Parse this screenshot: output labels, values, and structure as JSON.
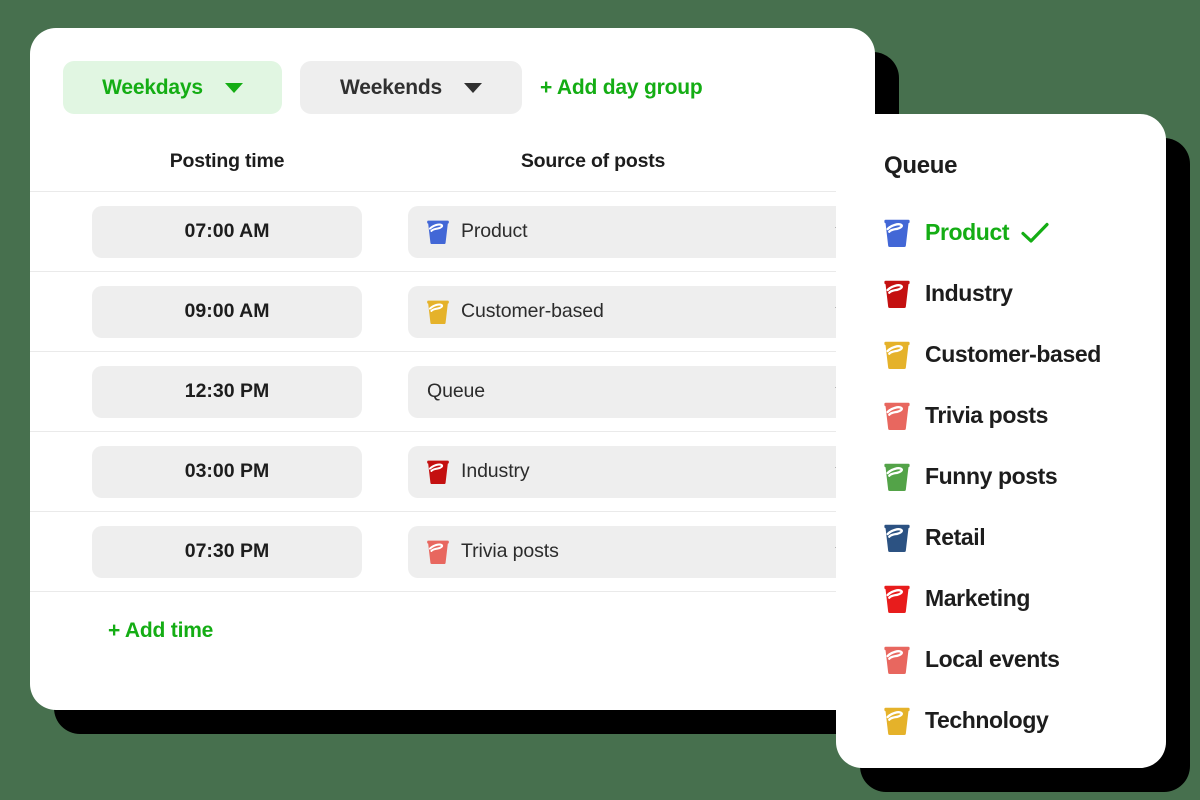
{
  "theme": {
    "background": "#47704e",
    "card": "#ffffff",
    "shadow": "#000000",
    "accent_green": "#14ad14",
    "accent_green_soft": "#e1f6e2",
    "field_gray": "#eeeeee",
    "text_dark": "#1d1d1d",
    "divider": "#eaeaea"
  },
  "day_groups": {
    "active": {
      "label": "Weekdays",
      "caret": "chevron-down-icon"
    },
    "inactive": {
      "label": "Weekends",
      "caret": "chevron-down-icon"
    },
    "add_label": "+ Add day group"
  },
  "table": {
    "headers": {
      "time": "Posting time",
      "source": "Source of posts"
    },
    "rows": [
      {
        "time": "07:00 AM",
        "source": "Product",
        "icon": "bucket-icon",
        "icon_color": "#4267d6",
        "has_icon": true
      },
      {
        "time": "09:00 AM",
        "source": "Customer-based",
        "icon": "bucket-icon",
        "icon_color": "#e5b22a",
        "has_icon": true
      },
      {
        "time": "12:30 PM",
        "source": "Queue",
        "icon": "",
        "icon_color": "",
        "has_icon": false
      },
      {
        "time": "03:00 PM",
        "source": "Industry",
        "icon": "bucket-icon",
        "icon_color": "#c41010",
        "has_icon": true
      },
      {
        "time": "07:30 PM",
        "source": "Trivia posts",
        "icon": "bucket-icon",
        "icon_color": "#e8675f",
        "has_icon": true
      }
    ],
    "add_time_label": "+ Add time"
  },
  "queue_panel": {
    "title": "Queue",
    "check_icon": "check-icon",
    "items": [
      {
        "label": "Product",
        "icon": "bucket-icon",
        "icon_color": "#4267d6",
        "selected": true
      },
      {
        "label": "Industry",
        "icon": "bucket-icon",
        "icon_color": "#c41010",
        "selected": false
      },
      {
        "label": "Customer-based",
        "icon": "bucket-icon",
        "icon_color": "#e5b22a",
        "selected": false
      },
      {
        "label": "Trivia posts",
        "icon": "bucket-icon",
        "icon_color": "#e8675f",
        "selected": false
      },
      {
        "label": "Funny posts",
        "icon": "bucket-icon",
        "icon_color": "#53a348",
        "selected": false
      },
      {
        "label": "Retail",
        "icon": "bucket-icon",
        "icon_color": "#2c5282",
        "selected": false
      },
      {
        "label": "Marketing",
        "icon": "bucket-icon",
        "icon_color": "#e81c1c",
        "selected": false
      },
      {
        "label": "Local events",
        "icon": "bucket-icon",
        "icon_color": "#e8675f",
        "selected": false
      },
      {
        "label": "Technology",
        "icon": "bucket-icon",
        "icon_color": "#e5b22a",
        "selected": false
      }
    ]
  }
}
